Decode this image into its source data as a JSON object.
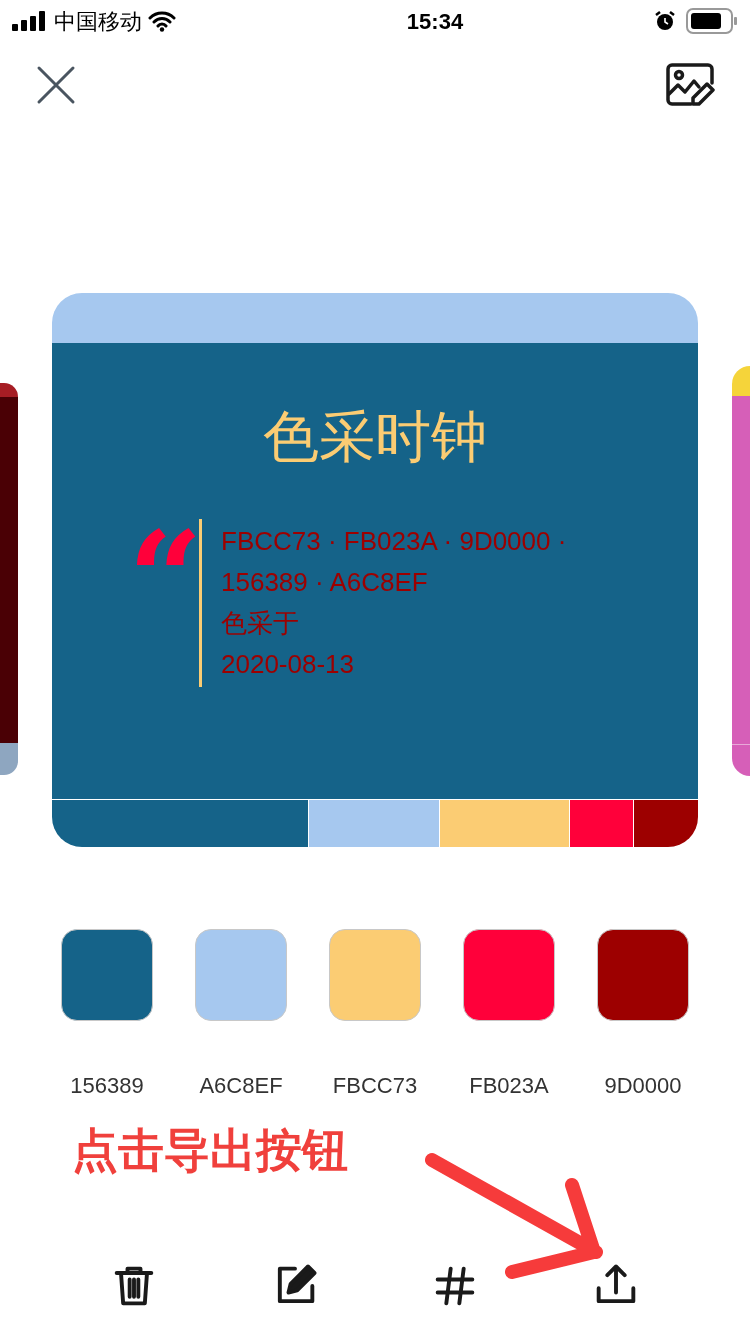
{
  "status_bar": {
    "carrier": "中国移动",
    "time": "15:34"
  },
  "card": {
    "title": "色采时钟",
    "quote_mark": "“",
    "lines": [
      "FBCC73 · FB023A · 9D0000 ·",
      "156389 · A6C8EF",
      "色采于",
      "2020-08-13"
    ],
    "strip": [
      {
        "color": "#156389"
      },
      {
        "color": "#a6c8ef"
      },
      {
        "color": "#fbcc73"
      },
      {
        "color": "#ff003a"
      },
      {
        "color": "#9d0000"
      }
    ]
  },
  "swatches": [
    {
      "color": "#156389",
      "label": "156389"
    },
    {
      "color": "#a6c8ef",
      "label": "A6C8EF"
    },
    {
      "color": "#fbcc73",
      "label": "FBCC73"
    },
    {
      "color": "#ff003a",
      "label": "FB023A"
    },
    {
      "color": "#9d0000",
      "label": "9D0000"
    }
  ],
  "annotation": {
    "text": "点击导出按钮"
  },
  "toolbar": [
    {
      "kind": "delete"
    },
    {
      "kind": "edit"
    },
    {
      "kind": "hash"
    },
    {
      "kind": "export"
    }
  ]
}
